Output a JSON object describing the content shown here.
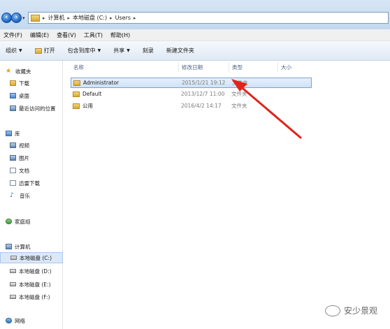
{
  "address": {
    "crumbs": [
      "计算机",
      "本地磁盘 (C:)",
      "Users"
    ]
  },
  "menu": [
    "文件(F)",
    "编辑(E)",
    "查看(V)",
    "工具(T)",
    "帮助(H)"
  ],
  "toolbar": {
    "organize": "组织",
    "open": "打开",
    "include": "包含到库中",
    "share": "共享",
    "burn": "刻录",
    "new_folder": "新建文件夹"
  },
  "nav": {
    "favorites": "收藏夹",
    "downloads": "下载",
    "desktop": "桌面",
    "recent": "最近访问的位置",
    "libraries": "库",
    "videos": "视频",
    "pictures": "图片",
    "documents": "文档",
    "xunlei": "迅雷下载",
    "music": "音乐",
    "homegroup": "家庭组",
    "computer": "计算机",
    "drive_c": "本地磁盘 (C:)",
    "drive_d": "本地磁盘 (D:)",
    "drive_e": "本地磁盘 (E:)",
    "drive_f": "本地磁盘 (F:)",
    "network": "网络"
  },
  "columns": {
    "name": "名称",
    "modified": "修改日期",
    "type": "类型",
    "size": "大小"
  },
  "files": [
    {
      "name": "Administrator",
      "date": "2015/1/21 19:12",
      "type": "文件夹"
    },
    {
      "name": "Default",
      "date": "2013/12/7 11:00",
      "type": "文件夹"
    },
    {
      "name": "公用",
      "date": "2016/4/2 14:17",
      "type": "文件夹"
    }
  ],
  "watermark": "安少景观",
  "colors": {
    "selection": "#cfe2f8",
    "arrow": "#e0241b"
  }
}
